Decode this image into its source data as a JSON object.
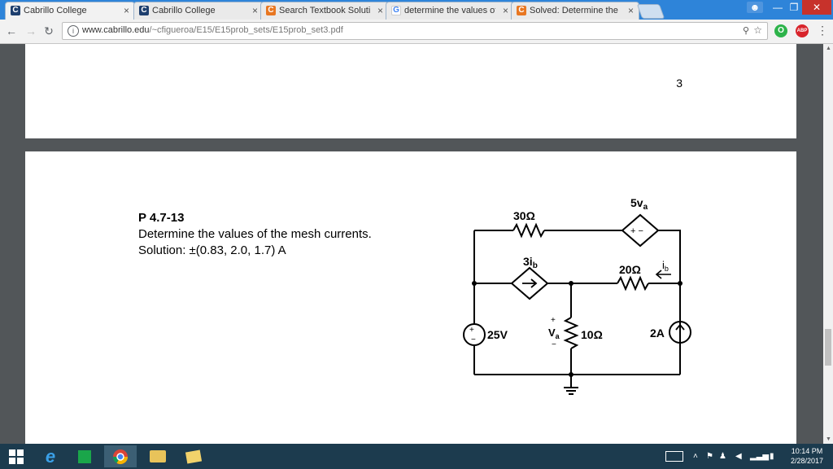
{
  "browser": {
    "tabs": [
      {
        "title": "Cabrillo College",
        "favicon": "cabrillo-icon",
        "active": true
      },
      {
        "title": "Cabrillo College",
        "favicon": "cabrillo-icon",
        "active": false
      },
      {
        "title": "Search Textbook Solutio",
        "favicon": "chegg-icon",
        "active": false
      },
      {
        "title": "determine the values of",
        "favicon": "google-icon",
        "active": false
      },
      {
        "title": "Solved: Determine the va",
        "favicon": "chegg-icon",
        "active": false
      }
    ],
    "close_glyph": "×",
    "url_host": "www.cabrillo.edu",
    "url_path": "/~cfigueroa/E15/E15prob_sets/E15prob_set3.pdf",
    "accent": "#2e84d9"
  },
  "pdf": {
    "page_number": "3",
    "problem_number": "P 4.7-13",
    "problem_text": "Determine the values of the mesh currents.",
    "solution_text": "Solution: ±(0.83, 2.0, 1.7) A",
    "circuit": {
      "r_top": "30Ω",
      "dep_vsource": "5v",
      "dep_vsource_sub": "a",
      "dep_isource": "3i",
      "dep_isource_sub": "b",
      "r_mid": "20Ω",
      "ib_label": "i",
      "ib_sub": "b",
      "v_source": "25V",
      "va_label": "V",
      "va_sub": "a",
      "r_bottom": "10Ω",
      "i_source": "2A"
    }
  },
  "taskbar": {
    "apps": [
      "windows-start-icon",
      "internet-explorer-icon",
      "store-icon",
      "chrome-icon",
      "file-explorer-icon",
      "folder-icon"
    ],
    "time": "10:14 PM",
    "date": "2/28/2017"
  }
}
